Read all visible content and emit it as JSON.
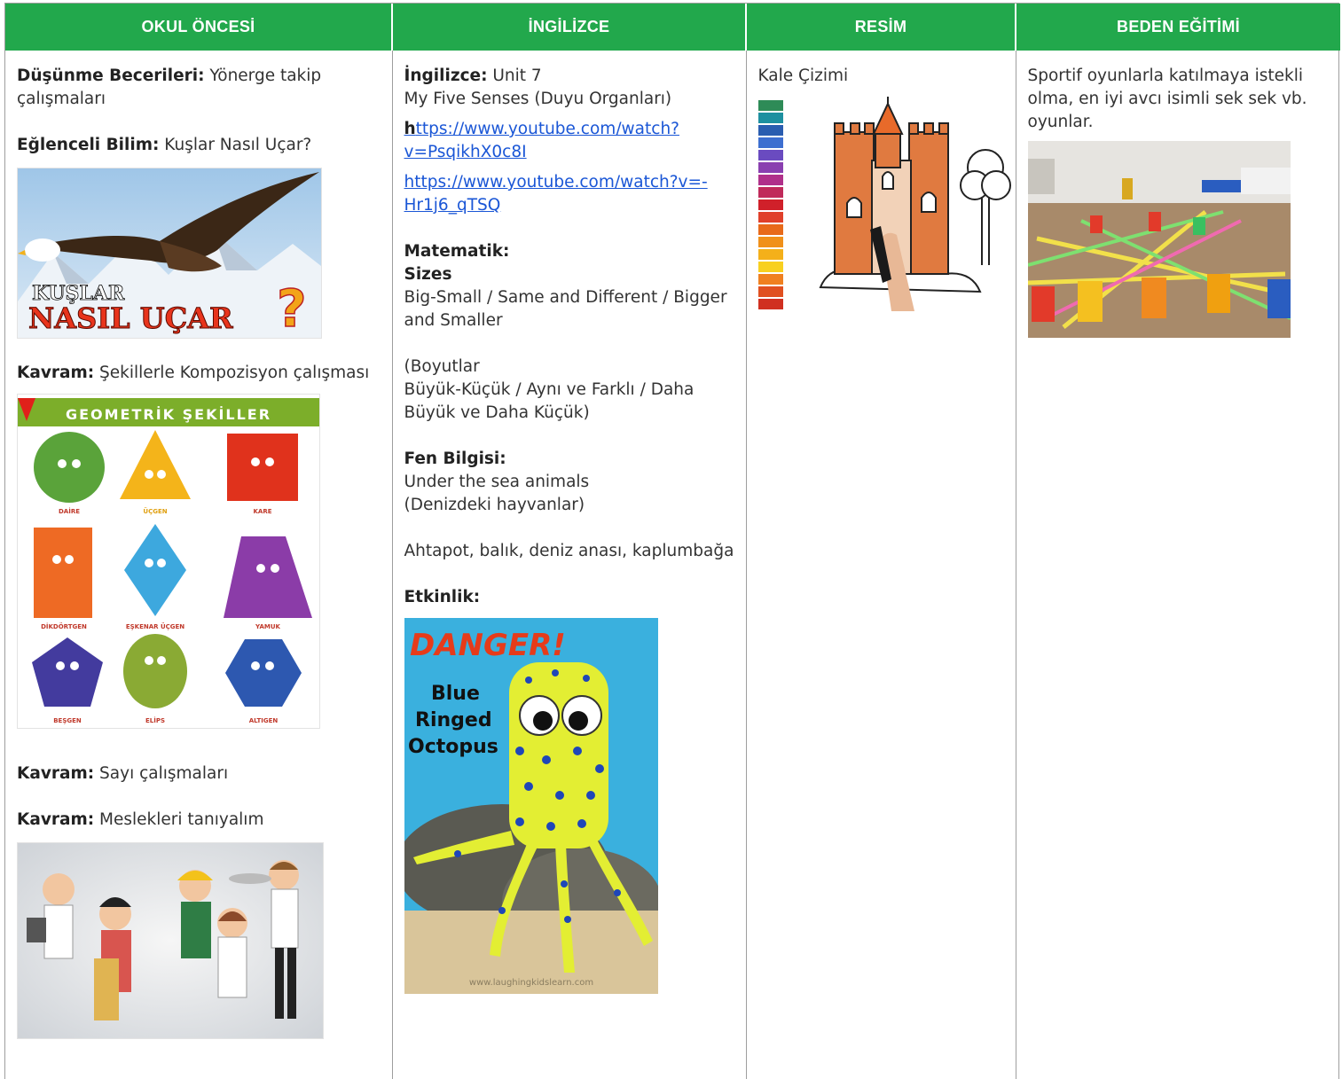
{
  "header": {
    "col1": "OKUL ÖNCESİ",
    "col2": "İNGİLİZCE",
    "col3": "RESİM",
    "col4": "BEDEN EĞİTİMİ"
  },
  "colors": {
    "header_bg": "#22a84c",
    "link": "#1a56d6",
    "border": "#9e9e9e"
  },
  "okul": {
    "dusunme_label": "Düşünme Becerileri:",
    "dusunme_text": " Yönerge takip çalışmaları",
    "bilim_label": "Eğlenceli Bilim:",
    "bilim_text": " Kuşlar Nasıl Uçar?",
    "bird_img": {
      "line1": "KUŞLAR",
      "line2": "NASIL UÇAR",
      "mark": "?"
    },
    "kavram1_label": "Kavram:",
    "kavram1_text": " Şekillerle Kompozisyon çalışması",
    "shapes_img": {
      "title": "GEOMETRİK ŞEKİLLER",
      "labels": [
        "DAİRE",
        "ÜÇGEN",
        "KARE",
        "DİKDÖRTGEN",
        "EŞKENAR ÜÇGEN",
        "YAMUK",
        "BEŞGEN",
        "ELİPS",
        "ALTIGEN"
      ]
    },
    "kavram2_label": "Kavram:",
    "kavram2_text": " Sayı çalışmaları",
    "kavram3_label": "Kavram:",
    "kavram3_text": " Meslekleri tanıyalım"
  },
  "ingilizce": {
    "unit_label": "İngilizce:",
    "unit_text": " Unit 7",
    "senses": "My Five Senses (Duyu Organları)",
    "link1_first": "h",
    "link1_rest": "ttps://www.youtube.com/watch?v=PsqikhX0c8I",
    "link2": "https://www.youtube.com/watch?v=-Hr1j6_qTSQ",
    "matematik_label": "Matematik:",
    "sizes_label": "Sizes",
    "sizes_text": "Big-Small / Same and Different / Bigger and Smaller",
    "boyut_line1": "(Boyutlar",
    "boyut_line2": "Büyük-Küçük / Aynı ve Farklı / Daha Büyük ve Daha Küçük)",
    "fen_label": "Fen Bilgisi:",
    "fen_line1": "Under the sea animals",
    "fen_line2": "(Denizdeki hayvanlar)",
    "animals": "Ahtapot, balık, deniz anası, kaplumbağa",
    "etkinlik_label": "Etkinlik:",
    "octopus_img": {
      "danger": "DANGER!",
      "l1": "Blue",
      "l2": "Ringed",
      "l3": "Octopus",
      "url": "www.laughingkidslearn.com"
    }
  },
  "resim": {
    "title": "Kale Çizimi"
  },
  "beden": {
    "text": "Sportif oyunlarla katılmaya istekli olma, en iyi avcı isimli sek sek vb. oyunlar."
  }
}
